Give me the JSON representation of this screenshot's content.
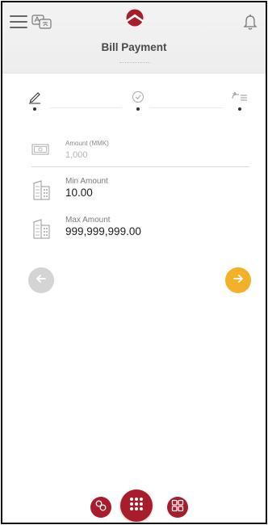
{
  "header": {
    "title": "Bill Payment",
    "icons": [
      "menu-icon",
      "language-icon",
      "bank-logo",
      "bell-icon"
    ]
  },
  "stepper": {
    "steps": [
      "edit-step-icon",
      "confirm-step-icon",
      "complete-step-icon"
    ],
    "active_index": 0
  },
  "amount": {
    "label": "Amount (MMK)",
    "placeholder": "1,000"
  },
  "min": {
    "label": "Min Amount",
    "value": "10.00"
  },
  "max": {
    "label": "Max Amount",
    "value": "999,999,999.00"
  },
  "nav": {
    "back_icon": "arrow-left-icon",
    "next_icon": "arrow-right-icon"
  },
  "bottom": {
    "icons": [
      "exchange-icon",
      "apps-grid-icon",
      "qr-icon"
    ]
  },
  "colors": {
    "brand": "#a91c2b",
    "accent": "#f3b129",
    "disabled": "#d4d4d4",
    "header_bg": "#f0f0f0"
  }
}
